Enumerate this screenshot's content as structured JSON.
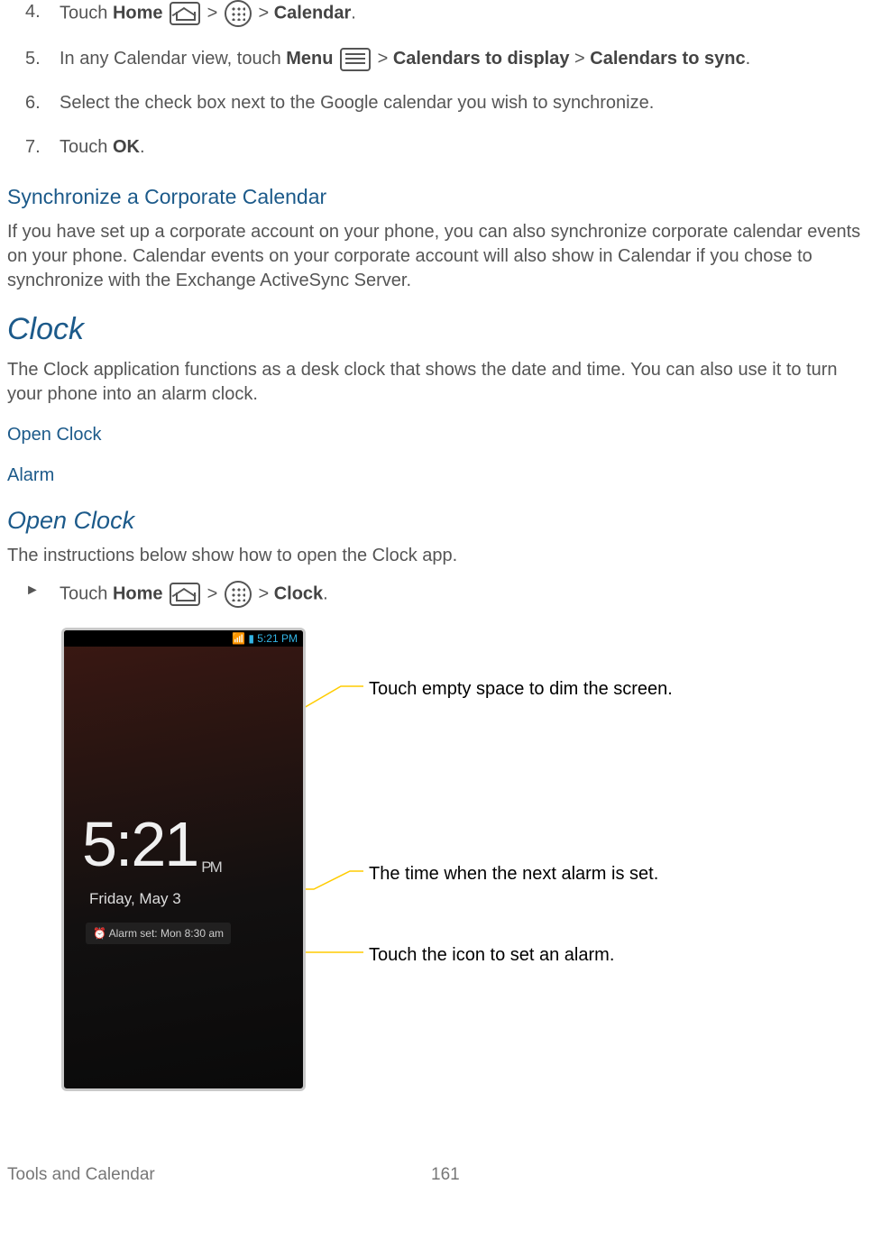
{
  "steps": {
    "s4": {
      "num": "4.",
      "pre": "Touch ",
      "bold1": "Home",
      "mid": " > ",
      "mid2": " > ",
      "bold2": "Calendar",
      "post": "."
    },
    "s5": {
      "num": "5.",
      "pre": "In any Calendar view, touch ",
      "bold1": "Menu",
      "mid": " > ",
      "bold2": "Calendars to display",
      "mid2": " > ",
      "bold3": "Calendars to sync",
      "post": "."
    },
    "s6": {
      "num": "6.",
      "text": "Select the check box next to the Google calendar you wish to synchronize."
    },
    "s7": {
      "num": "7.",
      "pre": "Touch ",
      "bold1": "OK",
      "post": "."
    }
  },
  "heading_sync_corp": "Synchronize a Corporate Calendar",
  "para_sync_corp": "If you have set up a corporate account on your phone, you can also synchronize corporate calendar events on your phone. Calendar events on your corporate account will also show in Calendar if you chose to synchronize with the Exchange ActiveSync Server.",
  "heading_clock": "Clock",
  "para_clock": "The Clock application functions as a desk clock that shows the date and time. You can also use it to turn your phone into an alarm clock.",
  "link_open_clock": "Open Clock",
  "link_alarm": "Alarm",
  "heading_open_clock": "Open Clock",
  "para_open_clock": "The instructions below show how to open the Clock app.",
  "bullet": {
    "marker": "►",
    "pre": "Touch ",
    "bold1": "Home",
    "mid": " > ",
    "mid2": " > ",
    "bold2": "Clock",
    "post": "."
  },
  "phone": {
    "status_time": "5:21 PM",
    "clock_time": "5:21",
    "clock_pm": "PM",
    "clock_date": "Friday, May 3",
    "alarm_set": "⏰ Alarm set: Mon 8:30 am"
  },
  "callouts": {
    "c1": "Touch empty space to dim the screen.",
    "c2": "The time when the next alarm is set.",
    "c3": "Touch the icon to set an alarm."
  },
  "footer": {
    "left": "Tools and Calendar",
    "page": "161"
  }
}
